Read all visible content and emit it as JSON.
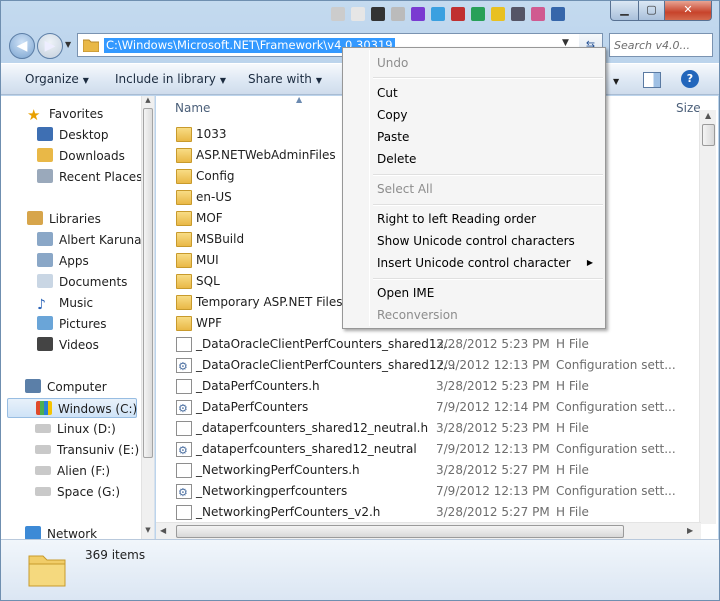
{
  "address": {
    "path": "C:\\Windows\\Microsoft.NET\\Framework\\v4.0.30319"
  },
  "search": {
    "placeholder": "Search v4.0..."
  },
  "toolbar": {
    "organize": "Organize",
    "include_in_library": "Include in library",
    "share_with": "Share with"
  },
  "navpane": {
    "favorites": "Favorites",
    "desktop": "Desktop",
    "downloads": "Downloads",
    "recent_places": "Recent Places",
    "libraries": "Libraries",
    "albert": "Albert Karuna",
    "apps": "Apps",
    "documents": "Documents",
    "music": "Music",
    "pictures": "Pictures",
    "videos": "Videos",
    "computer": "Computer",
    "windows_c": "Windows (C:)",
    "linux_d": "Linux (D:)",
    "transuniv_e": "Transuniv (E:)",
    "alien_f": "Alien (F:)",
    "space_g": "Space (G:)",
    "network": "Network"
  },
  "columns": {
    "name": "Name",
    "size": "Size"
  },
  "files": [
    {
      "name": "1033",
      "date": "",
      "type": "",
      "icon": "folder"
    },
    {
      "name": "ASP.NETWebAdminFiles",
      "date": "",
      "type": "",
      "icon": "folder"
    },
    {
      "name": "Config",
      "date": "",
      "type": "",
      "icon": "folder"
    },
    {
      "name": "en-US",
      "date": "",
      "type": "",
      "icon": "folder"
    },
    {
      "name": "MOF",
      "date": "",
      "type": "",
      "icon": "folder"
    },
    {
      "name": "MSBuild",
      "date": "",
      "type": "",
      "icon": "folder"
    },
    {
      "name": "MUI",
      "date": "",
      "type": "",
      "icon": "folder"
    },
    {
      "name": "SQL",
      "date": "",
      "type": "",
      "icon": "folder"
    },
    {
      "name": "Temporary ASP.NET Files",
      "date": "",
      "type": "",
      "icon": "folder"
    },
    {
      "name": "WPF",
      "date": "",
      "type": "",
      "icon": "folder"
    },
    {
      "name": "_DataOracleClientPerfCounters_shared12...",
      "date": "3/28/2012 5:23 PM",
      "type": "H File",
      "icon": "doc"
    },
    {
      "name": "_DataOracleClientPerfCounters_shared12...",
      "date": "7/9/2012 12:13 PM",
      "type": "Configuration sett...",
      "icon": "cfg"
    },
    {
      "name": "_DataPerfCounters.h",
      "date": "3/28/2012 5:23 PM",
      "type": "H File",
      "icon": "doc"
    },
    {
      "name": "_DataPerfCounters",
      "date": "7/9/2012 12:14 PM",
      "type": "Configuration sett...",
      "icon": "cfg"
    },
    {
      "name": "_dataperfcounters_shared12_neutral.h",
      "date": "3/28/2012 5:23 PM",
      "type": "H File",
      "icon": "doc"
    },
    {
      "name": "_dataperfcounters_shared12_neutral",
      "date": "7/9/2012 12:13 PM",
      "type": "Configuration sett...",
      "icon": "cfg"
    },
    {
      "name": "_NetworkingPerfCounters.h",
      "date": "3/28/2012 5:27 PM",
      "type": "H File",
      "icon": "doc"
    },
    {
      "name": "_Networkingperfcounters",
      "date": "7/9/2012 12:13 PM",
      "type": "Configuration sett...",
      "icon": "cfg"
    },
    {
      "name": "_NetworkingPerfCounters_v2.h",
      "date": "3/28/2012 5:27 PM",
      "type": "H File",
      "icon": "doc"
    }
  ],
  "status": {
    "count": "369 items"
  },
  "context_menu": {
    "undo": "Undo",
    "cut": "Cut",
    "copy": "Copy",
    "paste": "Paste",
    "delete": "Delete",
    "select_all": "Select All",
    "rtl": "Right to left Reading order",
    "show_unicode": "Show Unicode control characters",
    "insert_unicode": "Insert Unicode control character",
    "open_ime": "Open IME",
    "reconversion": "Reconversion"
  },
  "colors": {
    "selection": "#3399ff",
    "folder": "#e9b847",
    "chrome": "#c4daef"
  }
}
